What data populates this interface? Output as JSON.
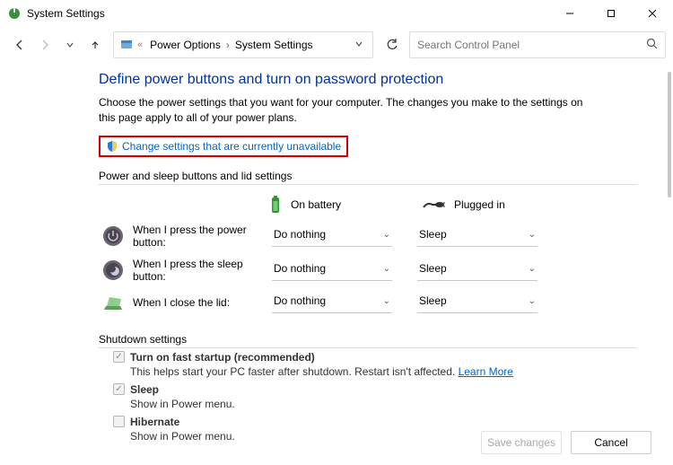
{
  "window": {
    "title": "System Settings"
  },
  "breadcrumb": {
    "item1": "Power Options",
    "item2": "System Settings"
  },
  "search": {
    "placeholder": "Search Control Panel"
  },
  "page": {
    "title": "Define power buttons and turn on password protection",
    "description": "Choose the power settings that you want for your computer. The changes you make to the settings on this page apply to all of your power plans.",
    "change_link": "Change settings that are currently unavailable"
  },
  "buttons_section": {
    "heading": "Power and sleep buttons and lid settings",
    "col_battery": "On battery",
    "col_plugged": "Plugged in",
    "rows": [
      {
        "label": "When I press the power button:",
        "battery": "Do nothing",
        "plugged": "Sleep"
      },
      {
        "label": "When I press the sleep button:",
        "battery": "Do nothing",
        "plugged": "Sleep"
      },
      {
        "label": "When I close the lid:",
        "battery": "Do nothing",
        "plugged": "Sleep"
      }
    ]
  },
  "shutdown_section": {
    "heading": "Shutdown settings",
    "items": [
      {
        "label": "Turn on fast startup (recommended)",
        "sub": "This helps start your PC faster after shutdown. Restart isn't affected.",
        "learn": "Learn More",
        "checked": true
      },
      {
        "label": "Sleep",
        "sub": "Show in Power menu.",
        "checked": true
      },
      {
        "label": "Hibernate",
        "sub": "Show in Power menu.",
        "checked": false
      }
    ]
  },
  "footer": {
    "save": "Save changes",
    "cancel": "Cancel"
  }
}
